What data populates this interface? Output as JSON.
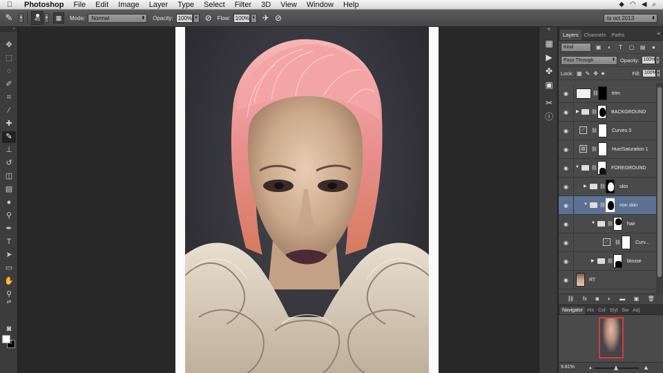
{
  "menubar": {
    "app": "Photoshop",
    "items": [
      "File",
      "Edit",
      "Image",
      "Layer",
      "Type",
      "Select",
      "Filter",
      "3D",
      "View",
      "Window",
      "Help"
    ]
  },
  "options": {
    "brush_size": "45",
    "mode_label": "Mode:",
    "mode_value": "Normal",
    "opacity_label": "Opacity:",
    "opacity_value": "100%",
    "flow_label": "Flow:",
    "flow_value": "100%",
    "workspace": "ts oct 2013"
  },
  "layers_panel": {
    "tabs": [
      "Layers",
      "Channels",
      "Paths"
    ],
    "filter_kind": "Kind",
    "blend_mode": "Pass Through",
    "opacity_label": "Opacity:",
    "opacity_value": "100%",
    "lock_label": "Lock:",
    "fill_label": "Fill:",
    "fill_value": "100%",
    "layers": [
      {
        "name": "trim"
      },
      {
        "name": "BACKGROUND"
      },
      {
        "name": "Curves 3"
      },
      {
        "name": "Hue/Saturation 1"
      },
      {
        "name": "FOREGROUND"
      },
      {
        "name": "skin"
      },
      {
        "name": "non skin"
      },
      {
        "name": "hair"
      },
      {
        "name": "Curv..."
      },
      {
        "name": "blouse"
      },
      {
        "name": "RT"
      }
    ]
  },
  "navigator": {
    "tabs": [
      "Navigator",
      "His",
      "Col",
      "Styl",
      "Sw",
      "Adj"
    ],
    "zoom": "9.81%"
  },
  "colors": {
    "selection": "#5b7191",
    "panel": "#4a4a4a"
  }
}
